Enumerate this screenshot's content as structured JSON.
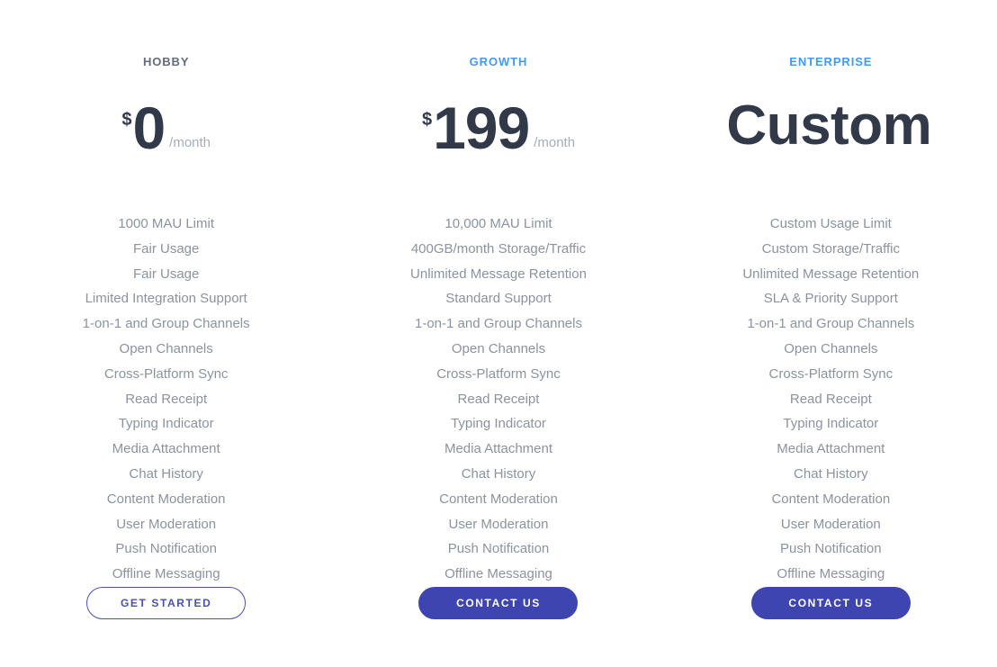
{
  "colors": {
    "accent_blue": "#3f9bf5",
    "plan_name_gray": "#646b7a",
    "price_dark": "#323a4a",
    "feature_gray": "#8c929e",
    "period_gray": "#a7adb8",
    "indigo": "#3f45b0",
    "indigo_outline": "#4a4fb5",
    "background": "#ffffff"
  },
  "plans": [
    {
      "name": "HOBBY",
      "currency": "$",
      "amount": "0",
      "period": "/month",
      "features": [
        "1000 MAU Limit",
        "Fair Usage",
        "Fair Usage",
        "Limited Integration Support",
        "1-on-1 and Group Channels",
        "Open Channels",
        "Cross-Platform Sync",
        "Read Receipt",
        "Typing Indicator",
        "Media Attachment",
        "Chat History",
        "Content Moderation",
        "User Moderation",
        "Push Notification",
        "Offline Messaging"
      ],
      "cta_label": "GET STARTED"
    },
    {
      "name": "GROWTH",
      "currency": "$",
      "amount": "199",
      "period": "/month",
      "features": [
        "10,000 MAU Limit",
        "400GB/month Storage/Traffic",
        "Unlimited Message Retention",
        "Standard Support",
        "1-on-1 and Group Channels",
        "Open Channels",
        "Cross-Platform Sync",
        "Read Receipt",
        "Typing Indicator",
        "Media Attachment",
        "Chat History",
        "Content Moderation",
        "User Moderation",
        "Push Notification",
        "Offline Messaging"
      ],
      "cta_label": "CONTACT US"
    },
    {
      "name": "ENTERPRISE",
      "currency": "",
      "amount": "Custom",
      "period": "",
      "features": [
        "Custom Usage Limit",
        "Custom Storage/Traffic",
        "Unlimited Message Retention",
        "SLA & Priority Support",
        "1-on-1 and Group Channels",
        "Open Channels",
        "Cross-Platform Sync",
        "Read Receipt",
        "Typing Indicator",
        "Media Attachment",
        "Chat History",
        "Content Moderation",
        "User Moderation",
        "Push Notification",
        "Offline Messaging"
      ],
      "cta_label": "CONTACT US"
    }
  ]
}
